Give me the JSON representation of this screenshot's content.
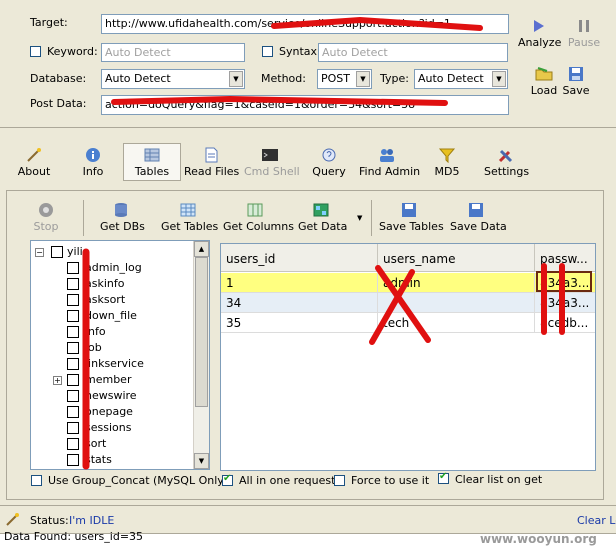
{
  "form": {
    "target_label": "Target:",
    "target_value": "http://www.ufidahealth.com/service/onlineSupport.action?id=1",
    "keyword_label": "Keyword:",
    "keyword_placeholder": "Auto Detect",
    "syntax_label": "Syntax:",
    "syntax_placeholder": "Auto Detect",
    "database_label": "Database:",
    "database_value": "Auto Detect",
    "method_label": "Method:",
    "method_value": "POST",
    "type_label": "Type:",
    "type_value": "Auto Detect",
    "postdata_label": "Post Data:",
    "postdata_value": "action=doQuery&flag=1&caseId=1&order=34&sort=38"
  },
  "side_buttons": {
    "analyze": "Analyze",
    "pause": "Pause",
    "load": "Load",
    "save": "Save"
  },
  "main_toolbar": [
    {
      "label": "About"
    },
    {
      "label": "Info"
    },
    {
      "label": "Tables"
    },
    {
      "label": "Read Files"
    },
    {
      "label": "Cmd Shell"
    },
    {
      "label": "Query"
    },
    {
      "label": "Find Admin"
    },
    {
      "label": "MD5"
    },
    {
      "label": "Settings"
    }
  ],
  "sub_toolbar": {
    "stop": "Stop",
    "get_dbs": "Get DBs",
    "get_tables": "Get Tables",
    "get_columns": "Get Columns",
    "get_data": "Get Data",
    "save_tables": "Save Tables",
    "save_data": "Save Data"
  },
  "tree": {
    "root": "yilia",
    "items": [
      {
        "label": "admin_log"
      },
      {
        "label": "askinfo"
      },
      {
        "label": "asksort"
      },
      {
        "label": "down_file"
      },
      {
        "label": "info"
      },
      {
        "label": "job"
      },
      {
        "label": "linkservice"
      },
      {
        "label": "member"
      },
      {
        "label": "newswire"
      },
      {
        "label": "onepage"
      },
      {
        "label": "sessions"
      },
      {
        "label": "sort"
      },
      {
        "label": "stats"
      }
    ]
  },
  "grid": {
    "columns": [
      "users_id",
      "users_name",
      "passw..."
    ],
    "rows": [
      [
        "1",
        "admin",
        "834a3..."
      ],
      [
        "34",
        "",
        "834a3..."
      ],
      [
        "35",
        "tech",
        "8cedb..."
      ]
    ]
  },
  "options": {
    "group_concat": "Use Group_Concat (MySQL Only)",
    "all_in_one": "All in one request.",
    "force": "Force to use it",
    "clear_list": "Clear list on get"
  },
  "status": {
    "label": "Status:",
    "value": "I'm IDLE",
    "clear_log": "Clear Lo"
  },
  "log_line": "Data Found: users_id=35",
  "watermark": "www.wooyun.org"
}
